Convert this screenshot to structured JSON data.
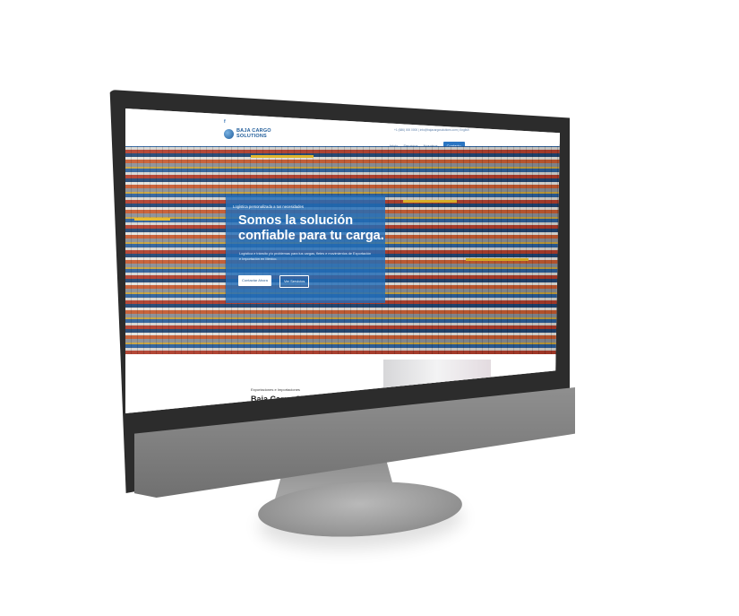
{
  "website": {
    "facebook_icon": "facebook-icon",
    "contact_line": "+1 (686) 000 0000 | info@bajacargosolutions.com | English",
    "logo": {
      "line1": "BAJA CARGO",
      "line2": "SOLUTIONS"
    },
    "nav": [
      "Inicio",
      "Servicios",
      "Nosotros",
      "Contacto"
    ],
    "hero": {
      "kicker": "Logística personalizada a tus necesidades",
      "title": "Somos la solución confiable para tu carga.",
      "subtitle": "Logística e tránsito y/o problemas para tus cargas, fletes e movimientos de Exportación e Importación en Mexico.",
      "primary_button": "Contactar Ahora",
      "secondary_button": "Ver Servicios"
    },
    "section": {
      "kicker": "Exportaciones e Importaciones",
      "title": "Baja Cargo Solutions"
    }
  },
  "colors": {
    "accent": "#2a75c2",
    "bezel": "#2c2c2c",
    "stand": "#9a9a9a"
  }
}
